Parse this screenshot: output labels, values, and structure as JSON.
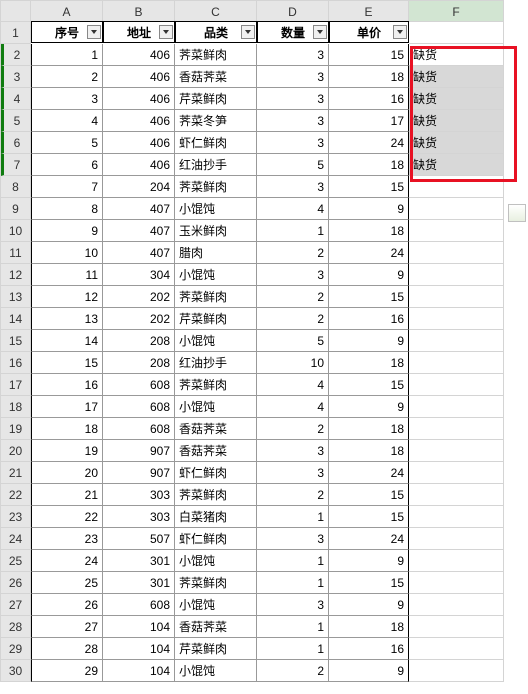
{
  "columns": [
    "A",
    "B",
    "C",
    "D",
    "E",
    "F"
  ],
  "headers": {
    "a": "序号",
    "b": "地址",
    "c": "品类",
    "d": "数量",
    "e": "单价"
  },
  "f_highlight": [
    "缺货",
    "缺货",
    "缺货",
    "缺货",
    "缺货",
    "缺货"
  ],
  "rows": [
    {
      "n": 2,
      "a": 1,
      "b": 406,
      "c": "荠菜鲜肉",
      "d": 3,
      "e": 15
    },
    {
      "n": 3,
      "a": 2,
      "b": 406,
      "c": "香菇荠菜",
      "d": 3,
      "e": 18
    },
    {
      "n": 4,
      "a": 3,
      "b": 406,
      "c": "芹菜鲜肉",
      "d": 3,
      "e": 16
    },
    {
      "n": 5,
      "a": 4,
      "b": 406,
      "c": "荠菜冬笋",
      "d": 3,
      "e": 17
    },
    {
      "n": 6,
      "a": 5,
      "b": 406,
      "c": "虾仁鲜肉",
      "d": 3,
      "e": 24
    },
    {
      "n": 7,
      "a": 6,
      "b": 406,
      "c": "红油抄手",
      "d": 5,
      "e": 18
    },
    {
      "n": 8,
      "a": 7,
      "b": 204,
      "c": "荠菜鲜肉",
      "d": 3,
      "e": 15
    },
    {
      "n": 9,
      "a": 8,
      "b": 407,
      "c": "小馄饨",
      "d": 4,
      "e": 9
    },
    {
      "n": 10,
      "a": 9,
      "b": 407,
      "c": "玉米鲜肉",
      "d": 1,
      "e": 18
    },
    {
      "n": 11,
      "a": 10,
      "b": 407,
      "c": "腊肉",
      "d": 2,
      "e": 24
    },
    {
      "n": 12,
      "a": 11,
      "b": 304,
      "c": "小馄饨",
      "d": 3,
      "e": 9
    },
    {
      "n": 13,
      "a": 12,
      "b": 202,
      "c": "荠菜鲜肉",
      "d": 2,
      "e": 15
    },
    {
      "n": 14,
      "a": 13,
      "b": 202,
      "c": "芹菜鲜肉",
      "d": 2,
      "e": 16
    },
    {
      "n": 15,
      "a": 14,
      "b": 208,
      "c": "小馄饨",
      "d": 5,
      "e": 9
    },
    {
      "n": 16,
      "a": 15,
      "b": 208,
      "c": "红油抄手",
      "d": 10,
      "e": 18
    },
    {
      "n": 17,
      "a": 16,
      "b": 608,
      "c": "荠菜鲜肉",
      "d": 4,
      "e": 15
    },
    {
      "n": 18,
      "a": 17,
      "b": 608,
      "c": "小馄饨",
      "d": 4,
      "e": 9
    },
    {
      "n": 19,
      "a": 18,
      "b": 608,
      "c": "香菇荠菜",
      "d": 2,
      "e": 18
    },
    {
      "n": 20,
      "a": 19,
      "b": 907,
      "c": "香菇荠菜",
      "d": 3,
      "e": 18
    },
    {
      "n": 21,
      "a": 20,
      "b": 907,
      "c": "虾仁鲜肉",
      "d": 3,
      "e": 24
    },
    {
      "n": 22,
      "a": 21,
      "b": 303,
      "c": "荠菜鲜肉",
      "d": 2,
      "e": 15
    },
    {
      "n": 23,
      "a": 22,
      "b": 303,
      "c": "白菜猪肉",
      "d": 1,
      "e": 15
    },
    {
      "n": 24,
      "a": 23,
      "b": 507,
      "c": "虾仁鲜肉",
      "d": 3,
      "e": 24
    },
    {
      "n": 25,
      "a": 24,
      "b": 301,
      "c": "小馄饨",
      "d": 1,
      "e": 9
    },
    {
      "n": 26,
      "a": 25,
      "b": 301,
      "c": "荠菜鲜肉",
      "d": 1,
      "e": 15
    },
    {
      "n": 27,
      "a": 26,
      "b": 608,
      "c": "小馄饨",
      "d": 3,
      "e": 9
    },
    {
      "n": 28,
      "a": 27,
      "b": 104,
      "c": "香菇荠菜",
      "d": 1,
      "e": 18
    },
    {
      "n": 29,
      "a": 28,
      "b": 104,
      "c": "芹菜鲜肉",
      "d": 1,
      "e": 16
    },
    {
      "n": 30,
      "a": 29,
      "b": 104,
      "c": "小馄饨",
      "d": 2,
      "e": 9
    }
  ]
}
